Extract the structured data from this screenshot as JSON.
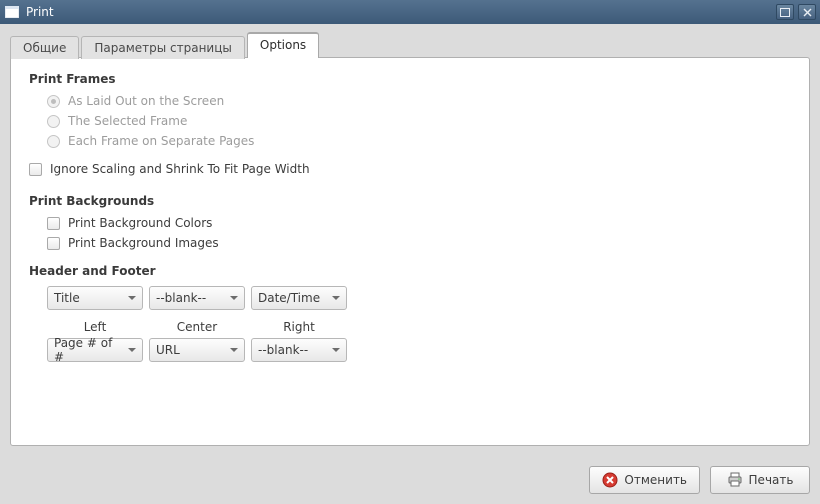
{
  "window": {
    "title": "Print"
  },
  "tabs": [
    {
      "label": "Общие"
    },
    {
      "label": "Параметры страницы"
    },
    {
      "label": "Options"
    }
  ],
  "sections": {
    "print_frames": {
      "title": "Print Frames",
      "options": [
        "As Laid Out on the Screen",
        "The Selected Frame",
        "Each Frame on Separate Pages"
      ]
    },
    "ignore_scaling": "Ignore Scaling and Shrink To Fit Page Width",
    "print_backgrounds": {
      "title": "Print Backgrounds",
      "options": [
        "Print Background Colors",
        "Print Background Images"
      ]
    },
    "header_footer": {
      "title": "Header and Footer",
      "row1": [
        "Title",
        "--blank--",
        "Date/Time"
      ],
      "labels": [
        "Left",
        "Center",
        "Right"
      ],
      "row2": [
        "Page # of #",
        "URL",
        "--blank--"
      ]
    }
  },
  "buttons": {
    "cancel": "Отменить",
    "print": "Печать"
  }
}
